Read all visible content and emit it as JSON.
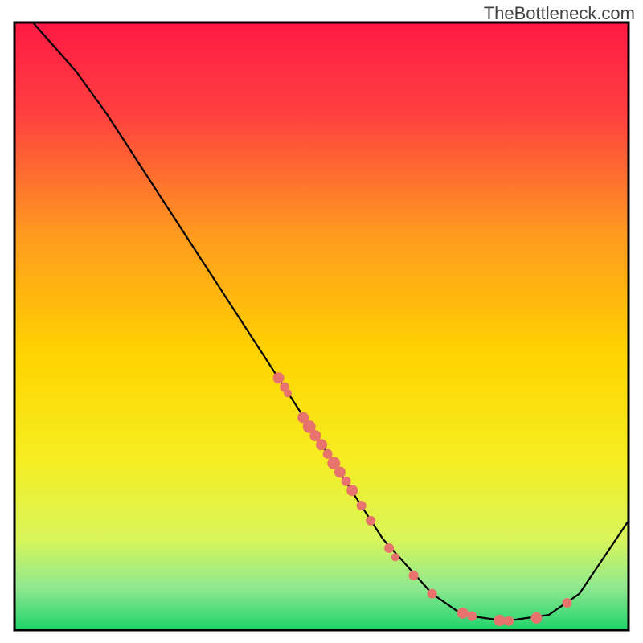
{
  "watermark": "TheBottleneck.com",
  "chart_data": {
    "type": "line",
    "title": "",
    "xlabel": "",
    "ylabel": "",
    "xlim": [
      0,
      100
    ],
    "ylim": [
      0,
      100
    ],
    "background": {
      "description": "vertical gradient bounded by black box, red at top through orange/yellow to green at bottom",
      "stops": [
        {
          "offset": 0.0,
          "color": "#ff1a44"
        },
        {
          "offset": 0.15,
          "color": "#ff4040"
        },
        {
          "offset": 0.35,
          "color": "#ff9a1f"
        },
        {
          "offset": 0.55,
          "color": "#ffd400"
        },
        {
          "offset": 0.72,
          "color": "#f5ee22"
        },
        {
          "offset": 0.85,
          "color": "#d9f55a"
        },
        {
          "offset": 0.93,
          "color": "#8fe88f"
        },
        {
          "offset": 1.0,
          "color": "#1fd36b"
        }
      ]
    },
    "series": [
      {
        "name": "curve",
        "stroke": "#000000",
        "points": [
          {
            "x": 3,
            "y": 100
          },
          {
            "x": 10,
            "y": 92
          },
          {
            "x": 15,
            "y": 85
          },
          {
            "x": 60,
            "y": 15
          },
          {
            "x": 68,
            "y": 6
          },
          {
            "x": 73,
            "y": 2.5
          },
          {
            "x": 80,
            "y": 1.5
          },
          {
            "x": 87,
            "y": 2.5
          },
          {
            "x": 92,
            "y": 6
          },
          {
            "x": 100,
            "y": 18
          }
        ]
      }
    ],
    "markers": {
      "color": "#e8736c",
      "radius_range": [
        5,
        9
      ],
      "points": [
        {
          "x": 43,
          "y": 41.5,
          "r": 7
        },
        {
          "x": 44,
          "y": 40,
          "r": 6
        },
        {
          "x": 44.5,
          "y": 39,
          "r": 5
        },
        {
          "x": 47,
          "y": 35,
          "r": 7
        },
        {
          "x": 48,
          "y": 33.5,
          "r": 8
        },
        {
          "x": 49,
          "y": 32,
          "r": 7
        },
        {
          "x": 50,
          "y": 30.5,
          "r": 7
        },
        {
          "x": 51,
          "y": 29,
          "r": 6
        },
        {
          "x": 52,
          "y": 27.5,
          "r": 8
        },
        {
          "x": 53,
          "y": 26,
          "r": 7
        },
        {
          "x": 54,
          "y": 24.5,
          "r": 6
        },
        {
          "x": 55,
          "y": 23,
          "r": 7
        },
        {
          "x": 56.5,
          "y": 20.5,
          "r": 6
        },
        {
          "x": 58,
          "y": 18,
          "r": 6
        },
        {
          "x": 61,
          "y": 13.5,
          "r": 6
        },
        {
          "x": 62,
          "y": 12,
          "r": 5
        },
        {
          "x": 65,
          "y": 9,
          "r": 6
        },
        {
          "x": 68,
          "y": 6,
          "r": 6
        },
        {
          "x": 73,
          "y": 2.8,
          "r": 7
        },
        {
          "x": 74.5,
          "y": 2.3,
          "r": 6
        },
        {
          "x": 79,
          "y": 1.6,
          "r": 7
        },
        {
          "x": 80.5,
          "y": 1.5,
          "r": 6
        },
        {
          "x": 85,
          "y": 2.0,
          "r": 7
        },
        {
          "x": 90,
          "y": 4.5,
          "r": 6
        }
      ]
    }
  }
}
